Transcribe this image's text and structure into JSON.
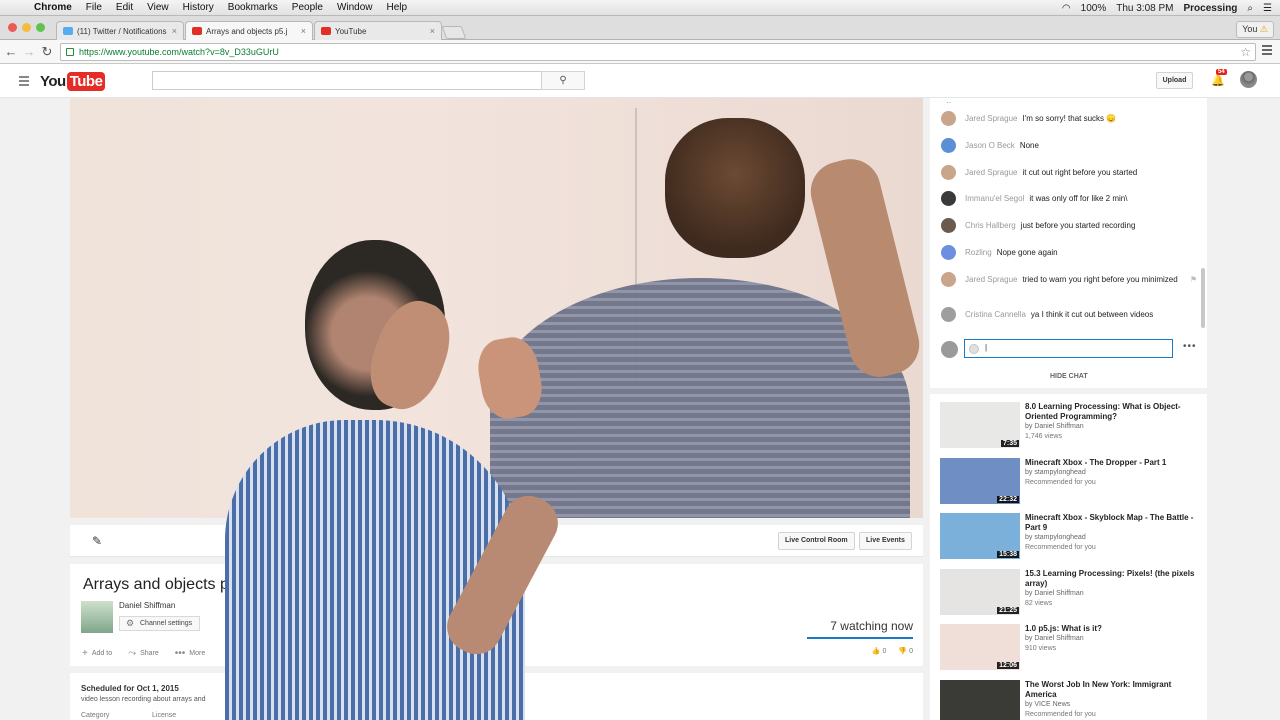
{
  "mac": {
    "menus": [
      "Chrome",
      "File",
      "Edit",
      "View",
      "History",
      "Bookmarks",
      "People",
      "Window",
      "Help"
    ],
    "battery": "100%",
    "clock": "Thu 3:08 PM",
    "app_name": "Processing"
  },
  "tabs": [
    {
      "title": "(11) Twitter / Notifications",
      "favicon": "twitter-icon",
      "color": "#55acee"
    },
    {
      "title": "Arrays and objects p5.j",
      "favicon": "youtube-icon",
      "color": "#e52d27"
    },
    {
      "title": "YouTube",
      "favicon": "youtube-icon",
      "color": "#e52d27"
    }
  ],
  "profile_label": "You",
  "url": "https://www.youtube.com/watch?v=8v_D33uGUrU",
  "yt": {
    "logo_you": "You",
    "logo_tube": "Tube",
    "search_placeholder": "",
    "upload_label": "Upload",
    "notification_count": "54"
  },
  "edit_bar": {
    "live_control_room": "Live Control Room",
    "live_events": "Live Events"
  },
  "video": {
    "title": "Arrays and objects p5",
    "owner": "Daniel Shiffman",
    "channel_settings": "Channel settings",
    "watching": "7 watching now",
    "add_to": "Add to",
    "share": "Share",
    "more": "More",
    "likes": "0",
    "dislikes": "0",
    "scheduled": "Scheduled for Oct 1, 2015",
    "description": "video lesson recording about arrays and",
    "category_label": "Category",
    "license_label": "License"
  },
  "chat": {
    "messages": [
      {
        "author": "Jared Sprague",
        "text": "I'm so sorry! that sucks 😞",
        "avatar_color": "#c9a58b"
      },
      {
        "author": "Jason O Beck",
        "text": "None",
        "avatar_color": "#5b8fd6"
      },
      {
        "author": "Jared Sprague",
        "text": "it cut out right before you started",
        "avatar_color": "#c9a58b"
      },
      {
        "author": "Immanu'el Segol",
        "text": "it was only off for like 2 min\\",
        "avatar_color": "#3a3a3a"
      },
      {
        "author": "Chris Hallberg",
        "text": "just before you started recording",
        "avatar_color": "#6b5a4e"
      },
      {
        "author": "Rozling",
        "text": "Nope gone again",
        "avatar_color": "#6c8fe0"
      },
      {
        "author": "Jared Sprague",
        "text": "tried to warn you right before you minimized",
        "avatar_color": "#c9a58b"
      },
      {
        "author": "Cristina Cannella",
        "text": "ya I think it cut out between videos",
        "avatar_color": "#9e9e9e"
      }
    ],
    "input_value": "|",
    "hide_chat": "HIDE CHAT"
  },
  "related": [
    {
      "title": "8.0 Learning Processing: What is Object-Oriented Programming?",
      "by": "by Daniel Shiffman",
      "meta": "1,746 views",
      "duration": "7:35",
      "thumb": "#e8e8e6"
    },
    {
      "title": "Minecraft Xbox - The Dropper - Part 1",
      "by": "by stampylonghead",
      "meta": "Recommended for you",
      "duration": "22:32",
      "thumb": "#6f8fc4"
    },
    {
      "title": "Minecraft Xbox - Skyblock Map - The Battle - Part 9",
      "by": "by stampylonghead",
      "meta": "Recommended for you",
      "duration": "15:38",
      "thumb": "#7ab0d9"
    },
    {
      "title": "15.3 Learning Processing: Pixels! (the pixels array)",
      "by": "by Daniel Shiffman",
      "meta": "82 views",
      "duration": "21:25",
      "thumb": "#e6e4e2"
    },
    {
      "title": "1.0 p5.js: What is it?",
      "by": "by Daniel Shiffman",
      "meta": "910 views",
      "duration": "12:06",
      "thumb": "#f0ded8"
    },
    {
      "title": "The Worst Job In New York: Immigrant America",
      "by": "by VICE News",
      "meta": "Recommended for you",
      "duration": "",
      "thumb": "#3a3a36"
    }
  ]
}
